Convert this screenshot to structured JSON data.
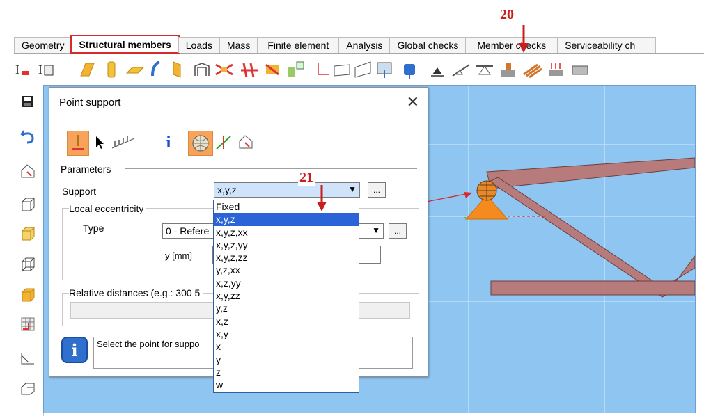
{
  "tabs": [
    {
      "label": "Geometry",
      "active": false
    },
    {
      "label": "Structural members",
      "active": true
    },
    {
      "label": "Loads",
      "active": false
    },
    {
      "label": "Mass",
      "active": false
    },
    {
      "label": "Finite element",
      "active": false
    },
    {
      "label": "Analysis",
      "active": false
    },
    {
      "label": "Global checks",
      "active": false
    },
    {
      "label": "Member checks",
      "active": false
    },
    {
      "label": "Serviceability ch",
      "active": false
    }
  ],
  "annotations": {
    "n20": "20",
    "n21": "21",
    "color": "#c81e1e"
  },
  "dialog": {
    "title": "Point support",
    "close": "✕",
    "parameters_label": "Parameters",
    "support_label": "Support",
    "support_value": "x,y,z",
    "local_ecc_label": "Local eccentricity",
    "type_label": "Type",
    "type_value": "0 - Refere",
    "y_label": "y [mm]",
    "relative_label": "Relative distances (e.g.: 300 5",
    "info_icon": "i",
    "message": "Select the point for suppo",
    "dots": "..."
  },
  "dropdown": {
    "options": [
      "Fixed",
      "x,y,z",
      "x,y,z,xx",
      "x,y,z,yy",
      "x,y,z,zz",
      "y,z,xx",
      "x,z,yy",
      "x,y,zz",
      "y,z",
      "x,z",
      "x,y",
      "x",
      "y",
      "z",
      "w"
    ],
    "selected_index": 1
  },
  "colors": {
    "canvas": "#8ec5f1",
    "beam": "#b87b7b",
    "support": "#f58a1f",
    "accent": "#d8292d",
    "selection": "#2a64d6"
  }
}
